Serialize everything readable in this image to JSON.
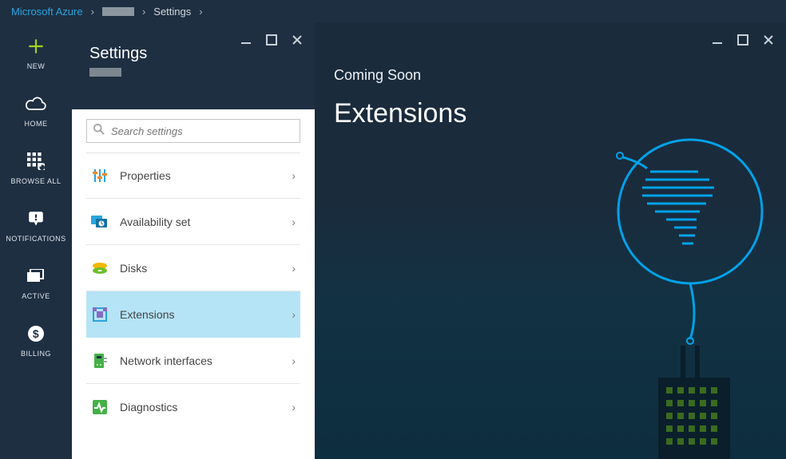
{
  "breadcrumb": {
    "root": "Microsoft Azure",
    "settings": "Settings"
  },
  "rail": {
    "new": "NEW",
    "home": "HOME",
    "browse": "BROWSE ALL",
    "notifications": "NOTIFICATIONS",
    "active": "ACTIVE",
    "billing": "BILLING"
  },
  "settingsBlade": {
    "title": "Settings",
    "searchPlaceholder": "Search settings",
    "items": {
      "properties": "Properties",
      "availability": "Availability set",
      "disks": "Disks",
      "extensions": "Extensions",
      "network": "Network interfaces",
      "diagnostics": "Diagnostics"
    }
  },
  "extensionsBlade": {
    "subtitle": "Coming Soon",
    "title": "Extensions"
  }
}
